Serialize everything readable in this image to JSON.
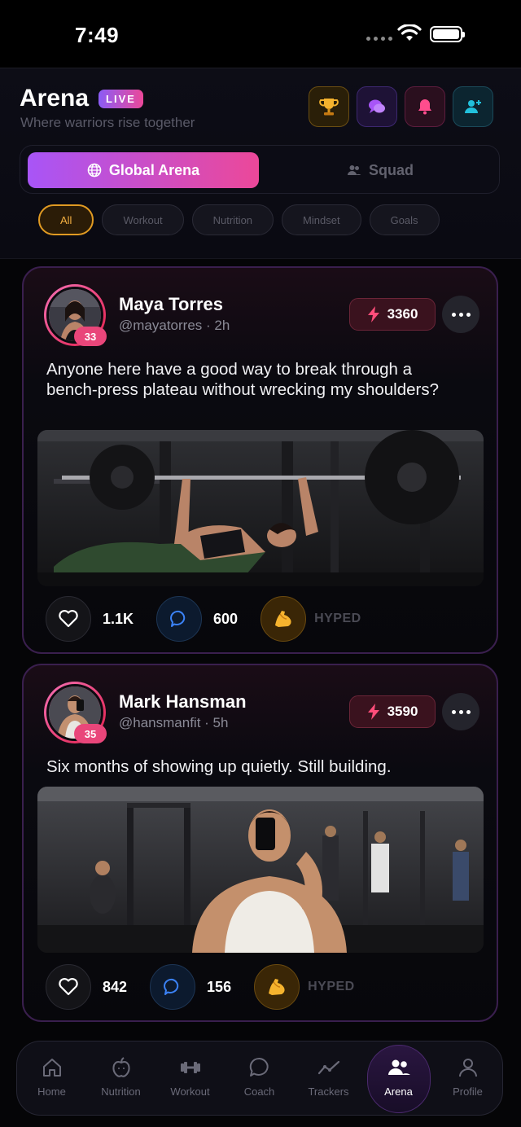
{
  "status_bar": {
    "time": "7:49"
  },
  "header": {
    "title": "Arena",
    "live_badge": "LIVE",
    "subtitle": "Where warriors rise together",
    "actions": [
      "trophy-icon",
      "chat-icon",
      "bell-icon",
      "add-user-icon"
    ]
  },
  "tabs": [
    {
      "label": "Global Arena",
      "icon": "globe-icon",
      "active": true
    },
    {
      "label": "Squad",
      "icon": "users-icon",
      "active": false
    }
  ],
  "filters": [
    {
      "label": "All",
      "active": true
    },
    {
      "label": "Workout",
      "active": false
    },
    {
      "label": "Nutrition",
      "active": false
    },
    {
      "label": "Mindset",
      "active": false
    },
    {
      "label": "Goals",
      "active": false
    }
  ],
  "posts": [
    {
      "name": "Maya Torres",
      "handle": "@mayatorres",
      "time": "2h",
      "level": "33",
      "score": "3360",
      "text": "Anyone here have a good way to break through a bench-press plateau without wrecking my shoulders?",
      "likes": "1.1K",
      "comments": "600",
      "hype_label": "HYPED"
    },
    {
      "name": "Mark Hansman",
      "handle": "@hansmanfit",
      "time": "5h",
      "level": "35",
      "score": "3590",
      "text": "Six months of showing up quietly. Still building.",
      "likes": "842",
      "comments": "156",
      "hype_label": "HYPED"
    }
  ],
  "nav": [
    {
      "label": "Home",
      "icon": "home-icon",
      "active": false
    },
    {
      "label": "Nutrition",
      "icon": "apple-icon",
      "active": false
    },
    {
      "label": "Workout",
      "icon": "dumbbell-icon",
      "active": false
    },
    {
      "label": "Coach",
      "icon": "chat-bubble-icon",
      "active": false
    },
    {
      "label": "Trackers",
      "icon": "trend-icon",
      "active": false
    },
    {
      "label": "Arena",
      "icon": "users-icon",
      "active": true
    },
    {
      "label": "Profile",
      "icon": "user-icon",
      "active": false
    }
  ],
  "colors": {
    "accent_purple": "#a855f7",
    "accent_pink": "#ec4899",
    "gold": "#e09a22"
  }
}
